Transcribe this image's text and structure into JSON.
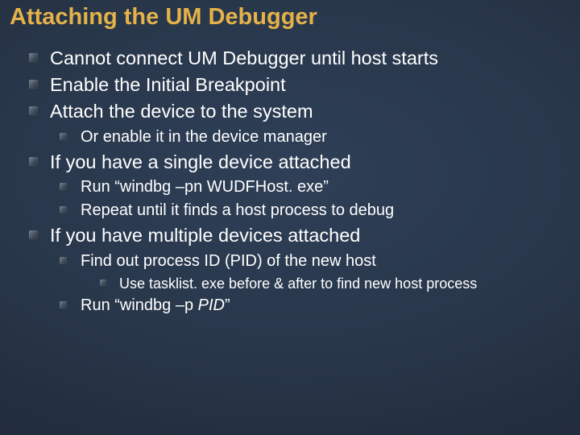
{
  "title": "Attaching the UM Debugger",
  "bullets": {
    "b1": "Cannot connect UM Debugger until host starts",
    "b2": "Enable the Initial Breakpoint",
    "b3": "Attach the device to the system",
    "b3_1": "Or enable it in the device manager",
    "b4": "If you have a single device attached",
    "b4_1": "Run “windbg –pn WUDFHost. exe”",
    "b4_2": "Repeat until it finds a host process to debug",
    "b5": "If you have multiple devices attached",
    "b5_1": "Find out process ID (PID) of the new host",
    "b5_1_1": "Use tasklist. exe before & after to find new host process",
    "b5_2a": "Run “windbg –p ",
    "b5_2b": "PID",
    "b5_2c": "”"
  }
}
